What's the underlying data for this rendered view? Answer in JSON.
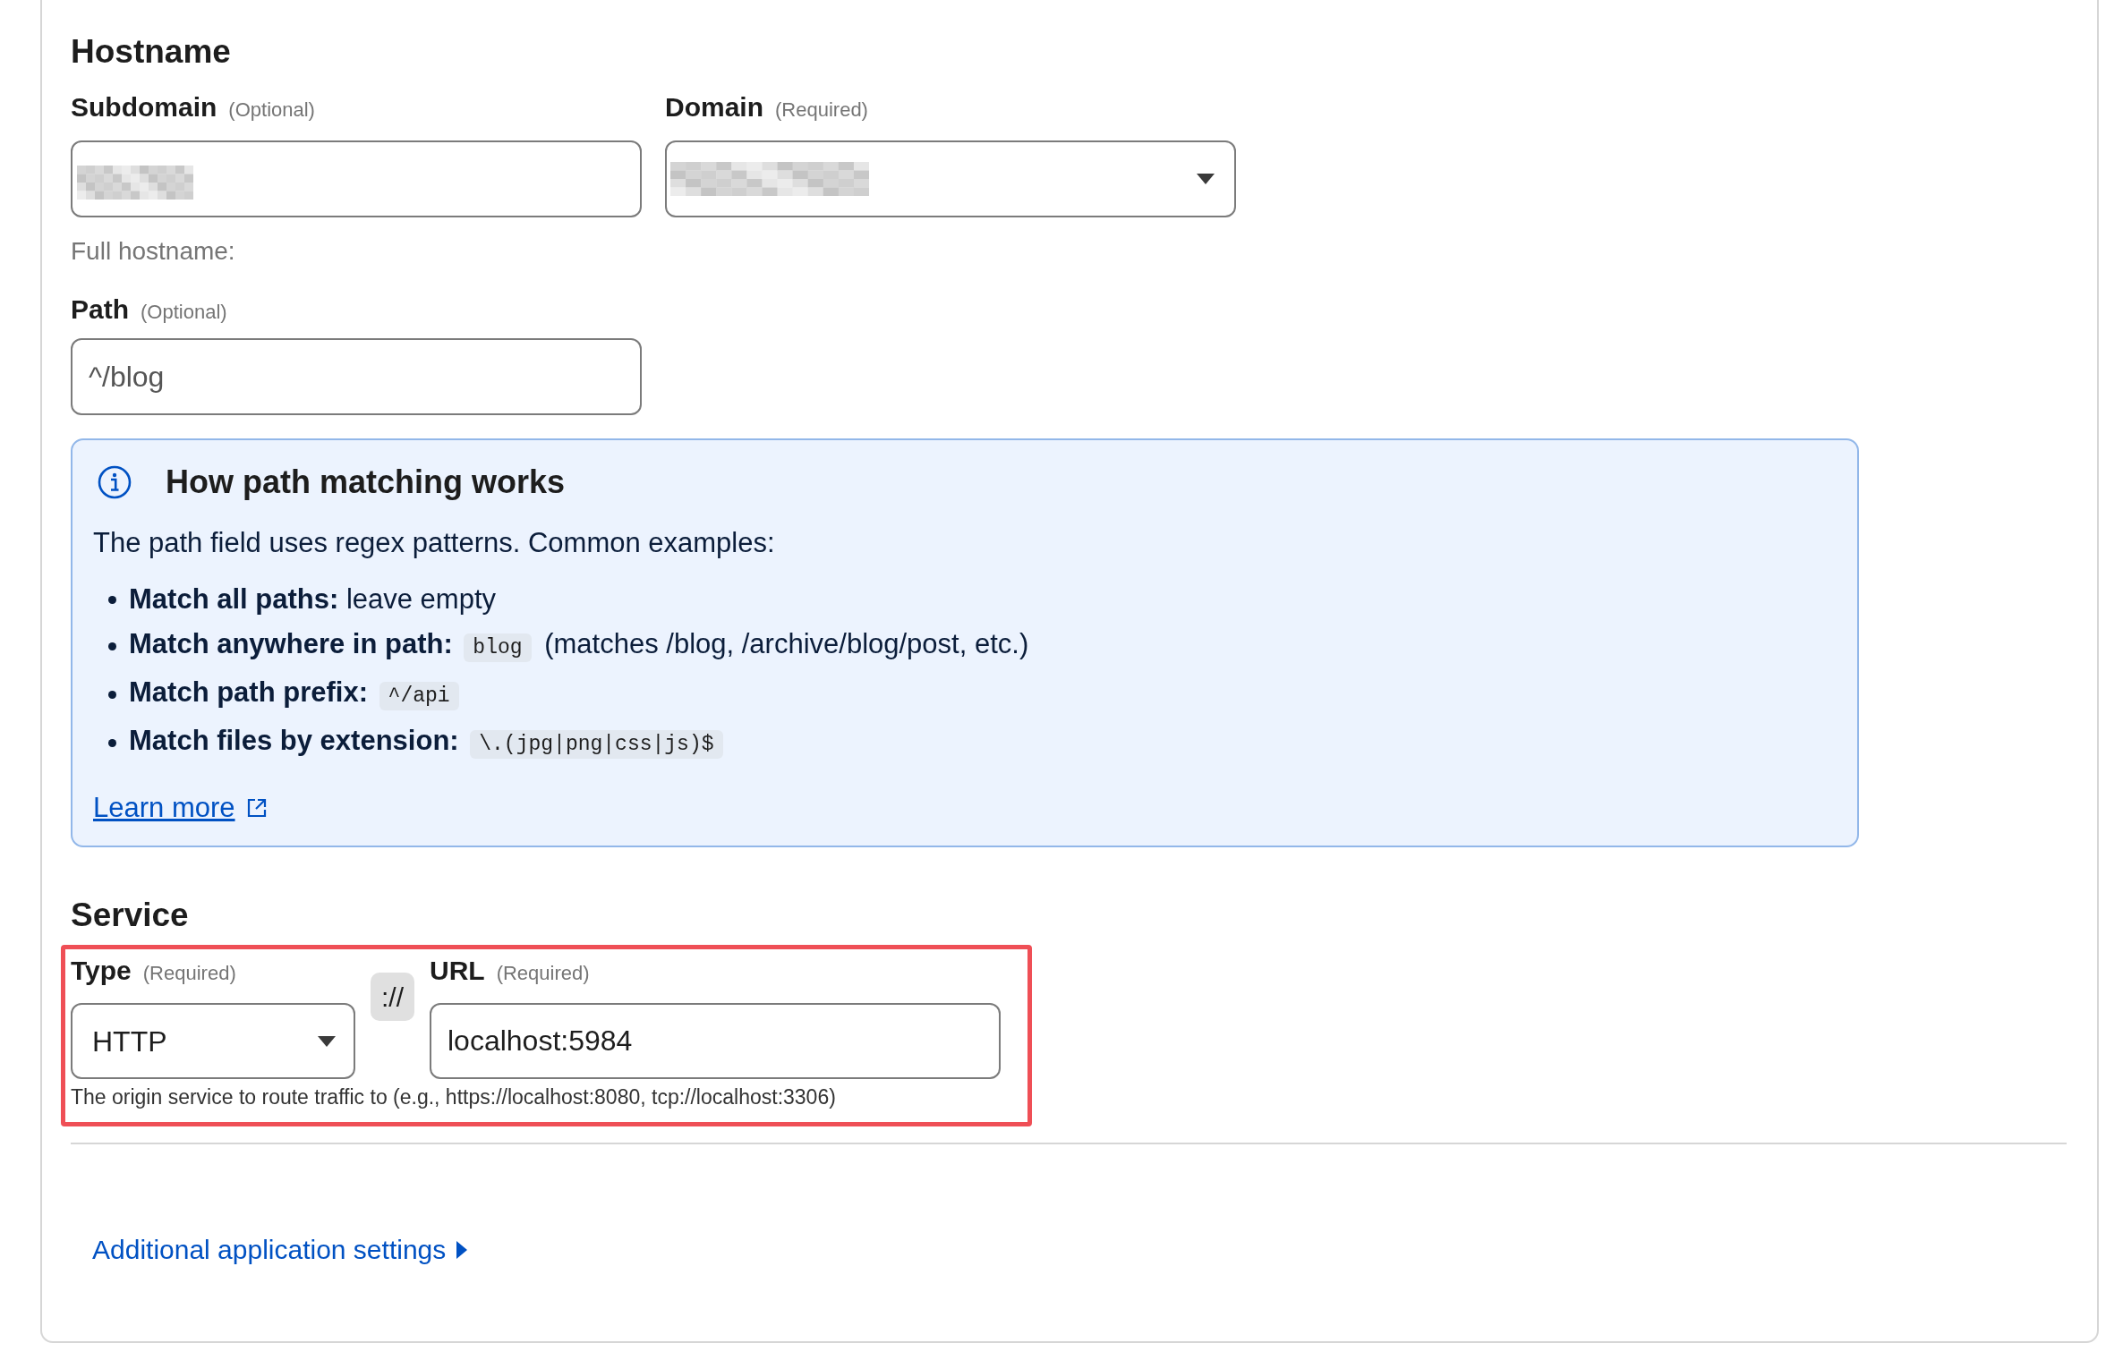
{
  "hostname": {
    "title": "Hostname",
    "subdomain": {
      "label": "Subdomain",
      "requirement": "(Optional)",
      "redacted": true
    },
    "domain": {
      "label": "Domain",
      "requirement": "(Required)",
      "redacted": true
    },
    "full_hostname": "Full hostname:",
    "path": {
      "label": "Path",
      "requirement": "(Optional)",
      "value": "^/blog"
    }
  },
  "path_help": {
    "title": "How path matching works",
    "intro": "The path field uses regex patterns. Common examples:",
    "examples": [
      {
        "term": "Match all paths:",
        "note": "leave empty"
      },
      {
        "term": "Match anywhere in path:",
        "code": "blog",
        "note": "(matches /blog, /archive/blog/post, etc.)"
      },
      {
        "term": "Match path prefix:",
        "code": "^/api"
      },
      {
        "term": "Match files by extension:",
        "code": "\\.(jpg|png|css|js)$"
      }
    ],
    "link": "Learn more"
  },
  "service": {
    "title": "Service",
    "highlighted": true,
    "type": {
      "label": "Type",
      "requirement": "(Required)",
      "value": "HTTP"
    },
    "separator": "://",
    "url": {
      "label": "URL",
      "requirement": "(Required)",
      "value": "localhost:5984"
    },
    "help": "The origin service to route traffic to (e.g., https://localhost:8080, tcp://localhost:3306)"
  },
  "additional_settings": {
    "label": "Additional application settings",
    "expanded": false
  }
}
